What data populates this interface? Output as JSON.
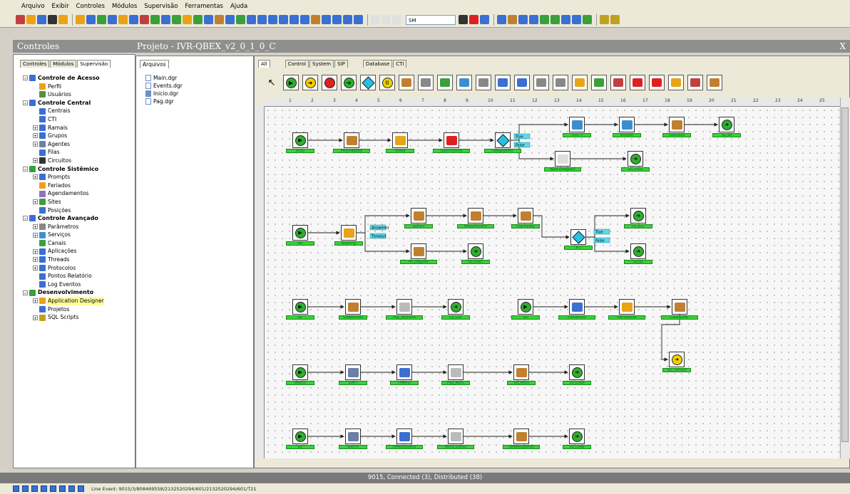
{
  "menu": [
    "Arquivo",
    "Exibir",
    "Controles",
    "Módulos",
    "Supervisão",
    "Ferramentas",
    "Ajuda"
  ],
  "toolbar": {
    "combo_value": "SM"
  },
  "left_title": "Controles",
  "left_tabs": [
    "Controles",
    "Módulos",
    "Supervisão"
  ],
  "project_title": "Projeto - IVR-QBEX_v2_0_1_0_C",
  "close_glyph": "X",
  "files_header": "Arquivos",
  "files": [
    "Main.dgr",
    "Events.dgr",
    "Inicio.dgr",
    "Pag.dgr"
  ],
  "canvas_tabs": [
    "All",
    "Control",
    "System",
    "SIP",
    "Database",
    "CTI"
  ],
  "tree": [
    {
      "label": "Controle de Acesso",
      "level": 0,
      "bold": true,
      "exp": "-",
      "color": "#3b6fd1"
    },
    {
      "label": "Perfil",
      "level": 1,
      "color": "#e8a317"
    },
    {
      "label": "Usuários",
      "level": 1,
      "color": "#5a8f3a"
    },
    {
      "label": "Controle Central",
      "level": 0,
      "bold": true,
      "exp": "-",
      "color": "#3b6fd1"
    },
    {
      "label": "Centrais",
      "level": 1,
      "color": "#3b6fd1"
    },
    {
      "label": "CTI",
      "level": 1,
      "color": "#3b6fd1"
    },
    {
      "label": "Ramais",
      "level": 1,
      "exp": "+",
      "color": "#3b6fd1"
    },
    {
      "label": "Grupos",
      "level": 1,
      "exp": "+",
      "color": "#3b6fd1"
    },
    {
      "label": "Agentes",
      "level": 1,
      "exp": "+",
      "color": "#6b7fa8"
    },
    {
      "label": "Filas",
      "level": 1,
      "color": "#3b6fd1"
    },
    {
      "label": "Circuitos",
      "level": 1,
      "exp": "+",
      "color": "#333333"
    },
    {
      "label": "Controle Sistêmico",
      "level": 0,
      "bold": true,
      "exp": "-",
      "color": "#3aa03a"
    },
    {
      "label": "Prompts",
      "level": 1,
      "exp": "+",
      "color": "#3b6fd1"
    },
    {
      "label": "Feriados",
      "level": 1,
      "color": "#e8a317"
    },
    {
      "label": "Agendamentos",
      "level": 1,
      "color": "#8f6fc0"
    },
    {
      "label": "Sites",
      "level": 1,
      "exp": "+",
      "color": "#3aa03a"
    },
    {
      "label": "Posições",
      "level": 1,
      "color": "#3b6fd1"
    },
    {
      "label": "Controle Avançado",
      "level": 0,
      "bold": true,
      "exp": "-",
      "color": "#3b6fd1"
    },
    {
      "label": "Parâmetros",
      "level": 1,
      "exp": "+",
      "color": "#888888"
    },
    {
      "label": "Serviços",
      "level": 1,
      "exp": "+",
      "color": "#3b8fd1"
    },
    {
      "label": "Canais",
      "level": 1,
      "color": "#3aa03a"
    },
    {
      "label": "Aplicações",
      "level": 1,
      "exp": "+",
      "color": "#3b6fd1"
    },
    {
      "label": "Threads",
      "level": 1,
      "exp": "+",
      "color": "#3b6fd1"
    },
    {
      "label": "Protocolos",
      "level": 1,
      "exp": "+",
      "color": "#3b6fd1"
    },
    {
      "label": "Pontos Relatório",
      "level": 1,
      "color": "#3b6fd1"
    },
    {
      "label": "Log Eventos",
      "level": 1,
      "color": "#3b6fd1"
    },
    {
      "label": "Desenvolvimento",
      "level": 0,
      "bold": true,
      "exp": "-",
      "color": "#3aa03a"
    },
    {
      "label": "Application Designer",
      "level": 1,
      "exp": "+",
      "color": "#e8a317",
      "selected": true
    },
    {
      "label": "Projetos",
      "level": 1,
      "color": "#3b6fd1"
    },
    {
      "label": "SQL Scripts",
      "level": 1,
      "exp": "+",
      "color": "#c0a020"
    }
  ],
  "nodes": [
    {
      "label": "Inicio",
      "icon": "start-icon"
    },
    {
      "label": "PeliculaNotas",
      "icon": "tool-icon"
    },
    {
      "label": "UsoDB",
      "icon": "database-icon"
    },
    {
      "label": "OpenChannel",
      "icon": "channel-icon"
    },
    {
      "label": "IsRegistered",
      "icon": "decision-icon"
    },
    {
      "label": "UseCTI",
      "icon": "monitor-icon"
    },
    {
      "label": "MonStat",
      "icon": "monitor-icon"
    },
    {
      "label": "ClearData",
      "icon": "tool-icon"
    },
    {
      "label": "Go_B0",
      "icon": "goto-icon"
    },
    {
      "label": "WaitForRegister",
      "icon": "timer-icon"
    },
    {
      "label": "Go_Inicio",
      "icon": "goto-icon"
    },
    {
      "label": "B0",
      "icon": "start-icon"
    },
    {
      "label": "WaitRing",
      "icon": "phone-icon"
    },
    {
      "label": "SetVars",
      "icon": "tool-icon"
    },
    {
      "label": "ReloadParams",
      "icon": "tool-icon"
    },
    {
      "label": "ChkHoliday",
      "icon": "tool-icon"
    },
    {
      "label": "IF1",
      "icon": "decision-icon"
    },
    {
      "label": "Go_B12",
      "icon": "goto-icon"
    },
    {
      "label": "Go_B1",
      "icon": "goto-icon"
    },
    {
      "label": "PIT_Register",
      "icon": "tool-icon"
    },
    {
      "label": "Go_LinkC",
      "icon": "goto-icon"
    },
    {
      "label": "B1",
      "icon": "start-icon"
    },
    {
      "label": "SetWelcome",
      "icon": "tool-icon"
    },
    {
      "label": "Play_Welcome",
      "icon": "speaker-icon"
    },
    {
      "label": "Go_Link",
      "icon": "goto-icon"
    },
    {
      "label": "B5",
      "icon": "start-icon"
    },
    {
      "label": "P.P.Retrieve",
      "icon": "form-icon"
    },
    {
      "label": "RetrieveCall",
      "icon": "phone-icon"
    },
    {
      "label": "ClearBuffer",
      "icon": "tool-icon"
    },
    {
      "label": "Go_Timeout",
      "icon": "goto-icon"
    },
    {
      "label": "BMenu",
      "icon": "start-icon"
    },
    {
      "label": "SetFT",
      "icon": "gear-icon"
    },
    {
      "label": "FPMenu",
      "icon": "form-icon"
    },
    {
      "label": "Play_Menu",
      "icon": "speaker-icon"
    },
    {
      "label": "Set_Menu",
      "icon": "tool-icon"
    },
    {
      "label": "Go_LinkA",
      "icon": "goto-icon"
    },
    {
      "label": "B2",
      "icon": "start-icon"
    },
    {
      "label": "SetFTA",
      "icon": "gear-icon"
    },
    {
      "label": "FPMenuOutros",
      "icon": "form-icon"
    },
    {
      "label": "Menu_Outros",
      "icon": "speaker-icon"
    },
    {
      "label": "DetMenuOutros",
      "icon": "tool-icon"
    },
    {
      "label": "Go_LinkB",
      "icon": "goto-icon"
    }
  ],
  "branch_labels": [
    "True",
    "False",
    "Answered",
    "Timeout",
    "True",
    "False"
  ],
  "status_text": "9015, Connected (3), Distributed (38)",
  "bottom_text": "Line Event: 9015/3/808469558/2132520294/601/2132520294/601/T21",
  "colors": {
    "label_green": "#3ad03a",
    "start": "#2fae2f",
    "goto": "#2fae2f",
    "yellow": "#f2d000",
    "red": "#e02020",
    "cyan": "#28c0e0"
  }
}
